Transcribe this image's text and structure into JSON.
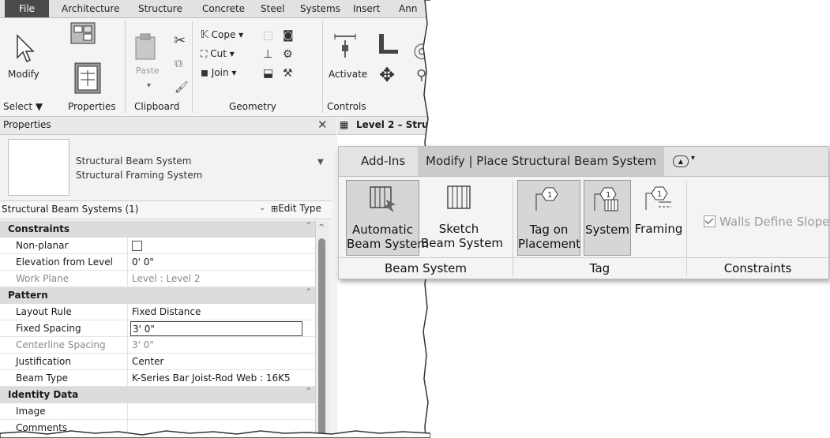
{
  "menu": {
    "items": [
      "File",
      "Architecture",
      "Structure",
      "Concrete",
      "Steel",
      "Systems",
      "Insert",
      "Ann"
    ]
  },
  "ribbon": {
    "modify_label": "Modify",
    "select_label": "Select ▼",
    "properties_label": "Properties",
    "paste_label": "Paste",
    "clipboard_label": "Clipboard",
    "cope_label": "Cope ▾",
    "cut_label": "Cut ▾",
    "join_label": "Join ▾",
    "geometry_label": "Geometry",
    "activate_label": "Activate",
    "controls_label": "Controls"
  },
  "properties": {
    "title": "Properties",
    "close": "✕",
    "type_line1": "Structural Beam System",
    "type_line2": "Structural Framing System",
    "filter": "Structural Beam Systems (1)",
    "edit_type": "Edit Type",
    "categories": {
      "constraints": "Constraints",
      "pattern": "Pattern",
      "identity": "Identity Data"
    },
    "rows": {
      "non_planar": "Non-planar",
      "elevation": "Elevation from Level",
      "elevation_value": "0'  0\"",
      "work_plane": "Work Plane",
      "work_plane_value": "Level : Level 2",
      "layout_rule": "Layout Rule",
      "layout_rule_value": "Fixed Distance",
      "fixed_spacing": "Fixed Spacing",
      "fixed_spacing_value": "3'  0\"",
      "centerline_spacing": "Centerline Spacing",
      "centerline_spacing_value": "3'  0\"",
      "justification": "Justification",
      "justification_value": "Center",
      "beam_type": "Beam Type",
      "beam_type_value": "K-Series Bar Joist-Rod Web : 16K5",
      "image": "Image",
      "comments": "Comments"
    }
  },
  "view_tab": {
    "title": "Level 2 – Stru"
  },
  "overlay": {
    "tabs": {
      "addins": "Add-Ins",
      "modify": "Modify | Place Structural Beam System"
    },
    "buttons": {
      "automatic_1": "Automatic",
      "automatic_2": "Beam System",
      "sketch_1": "Sketch",
      "sketch_2": "Beam System",
      "tag_on_1": "Tag on",
      "tag_on_2": "Placement",
      "system": "System",
      "framing": "Framing",
      "walls_define_slope": "Walls Define Slope"
    },
    "groups": {
      "beam_system": "Beam System",
      "tag": "Tag",
      "constraints": "Constraints"
    }
  }
}
